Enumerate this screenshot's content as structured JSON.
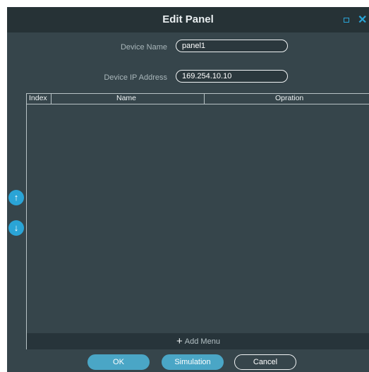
{
  "dialog": {
    "title": "Edit Panel",
    "close_glyph": "✕"
  },
  "form": {
    "device_name_label": "Device Name",
    "device_name_value": "panel1",
    "device_ip_label": "Device IP Address",
    "device_ip_value": "169.254.10.10"
  },
  "table": {
    "columns": [
      "Index",
      "Name",
      "Opration"
    ],
    "rows": []
  },
  "add_menu": {
    "icon": "plus-icon",
    "plus_glyph": "+",
    "label": "Add Menu"
  },
  "side_buttons": {
    "up_icon": "arrow-up-icon",
    "up_glyph": "↑",
    "down_icon": "arrow-down-icon",
    "down_glyph": "↓"
  },
  "buttons": {
    "ok": "OK",
    "simulation": "Simulation",
    "cancel": "Cancel"
  },
  "colors": {
    "dialog_bg": "#36454b",
    "titlebar_bg": "#263236",
    "accent": "#2aa4d6",
    "button_fill": "#4aa6c6"
  }
}
